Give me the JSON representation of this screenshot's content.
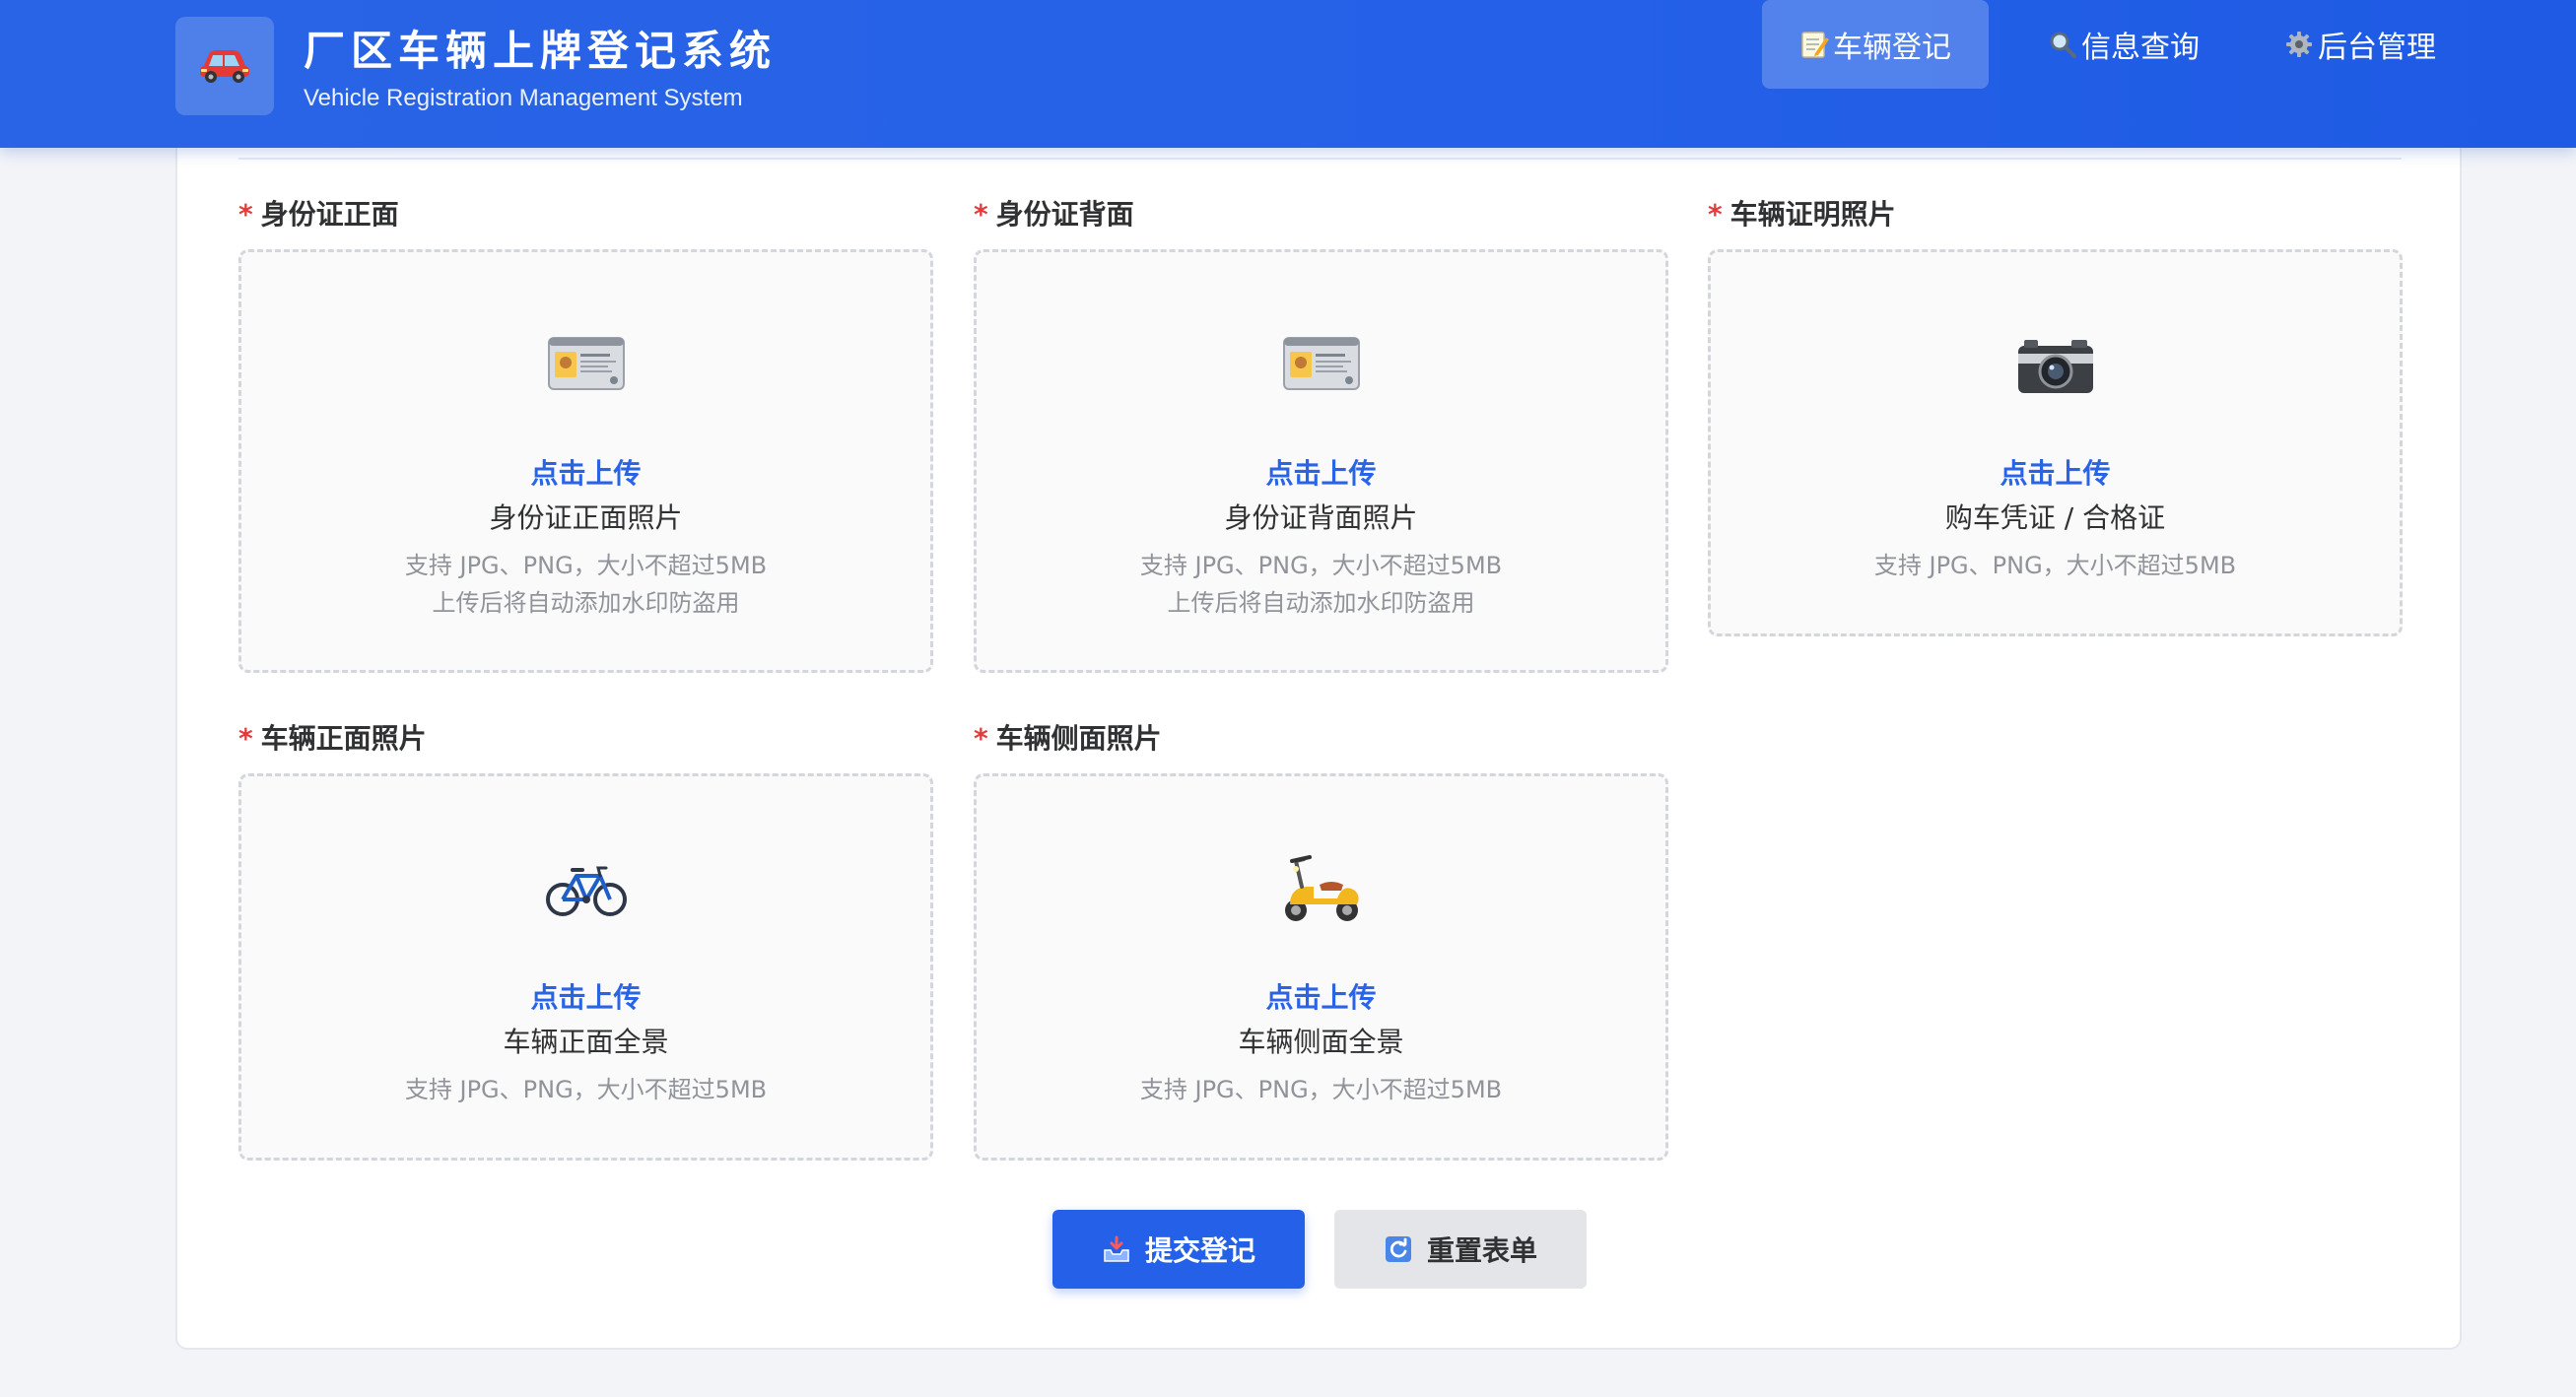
{
  "header": {
    "title": "厂区车辆上牌登记系统",
    "subtitle": "Vehicle Registration Management System",
    "logo_icon": "car-icon",
    "nav": [
      {
        "label": "车辆登记",
        "icon": "memo-icon",
        "active": true
      },
      {
        "label": "信息查询",
        "icon": "magnifier-icon",
        "active": false
      },
      {
        "label": "后台管理",
        "icon": "gear-icon",
        "active": false
      }
    ]
  },
  "fields": [
    {
      "label": "身份证正面",
      "required": "*",
      "icon": "id-card-icon",
      "click": "点击上传",
      "desc": "身份证正面照片",
      "hint1": "支持 JPG、PNG，大小不超过5MB",
      "hint2": "上传后将自动添加水印防盗用"
    },
    {
      "label": "身份证背面",
      "required": "*",
      "icon": "id-card-icon",
      "click": "点击上传",
      "desc": "身份证背面照片",
      "hint1": "支持 JPG、PNG，大小不超过5MB",
      "hint2": "上传后将自动添加水印防盗用"
    },
    {
      "label": "车辆证明照片",
      "required": "*",
      "icon": "camera-icon",
      "click": "点击上传",
      "desc": "购车凭证 / 合格证",
      "hint1": "支持 JPG、PNG，大小不超过5MB"
    },
    {
      "label": "车辆正面照片",
      "required": "*",
      "icon": "bicycle-icon",
      "click": "点击上传",
      "desc": "车辆正面全景",
      "hint1": "支持 JPG、PNG，大小不超过5MB"
    },
    {
      "label": "车辆侧面照片",
      "required": "*",
      "icon": "scooter-icon",
      "click": "点击上传",
      "desc": "车辆侧面全景",
      "hint1": "支持 JPG、PNG，大小不超过5MB"
    }
  ],
  "actions": {
    "submit_label": "提交登记",
    "submit_icon": "inbox-tray-icon",
    "reset_label": "重置表单",
    "reset_icon": "refresh-icon"
  },
  "colors": {
    "primary": "#2461e8",
    "required": "#e33b3b",
    "link": "#2a64e6"
  }
}
